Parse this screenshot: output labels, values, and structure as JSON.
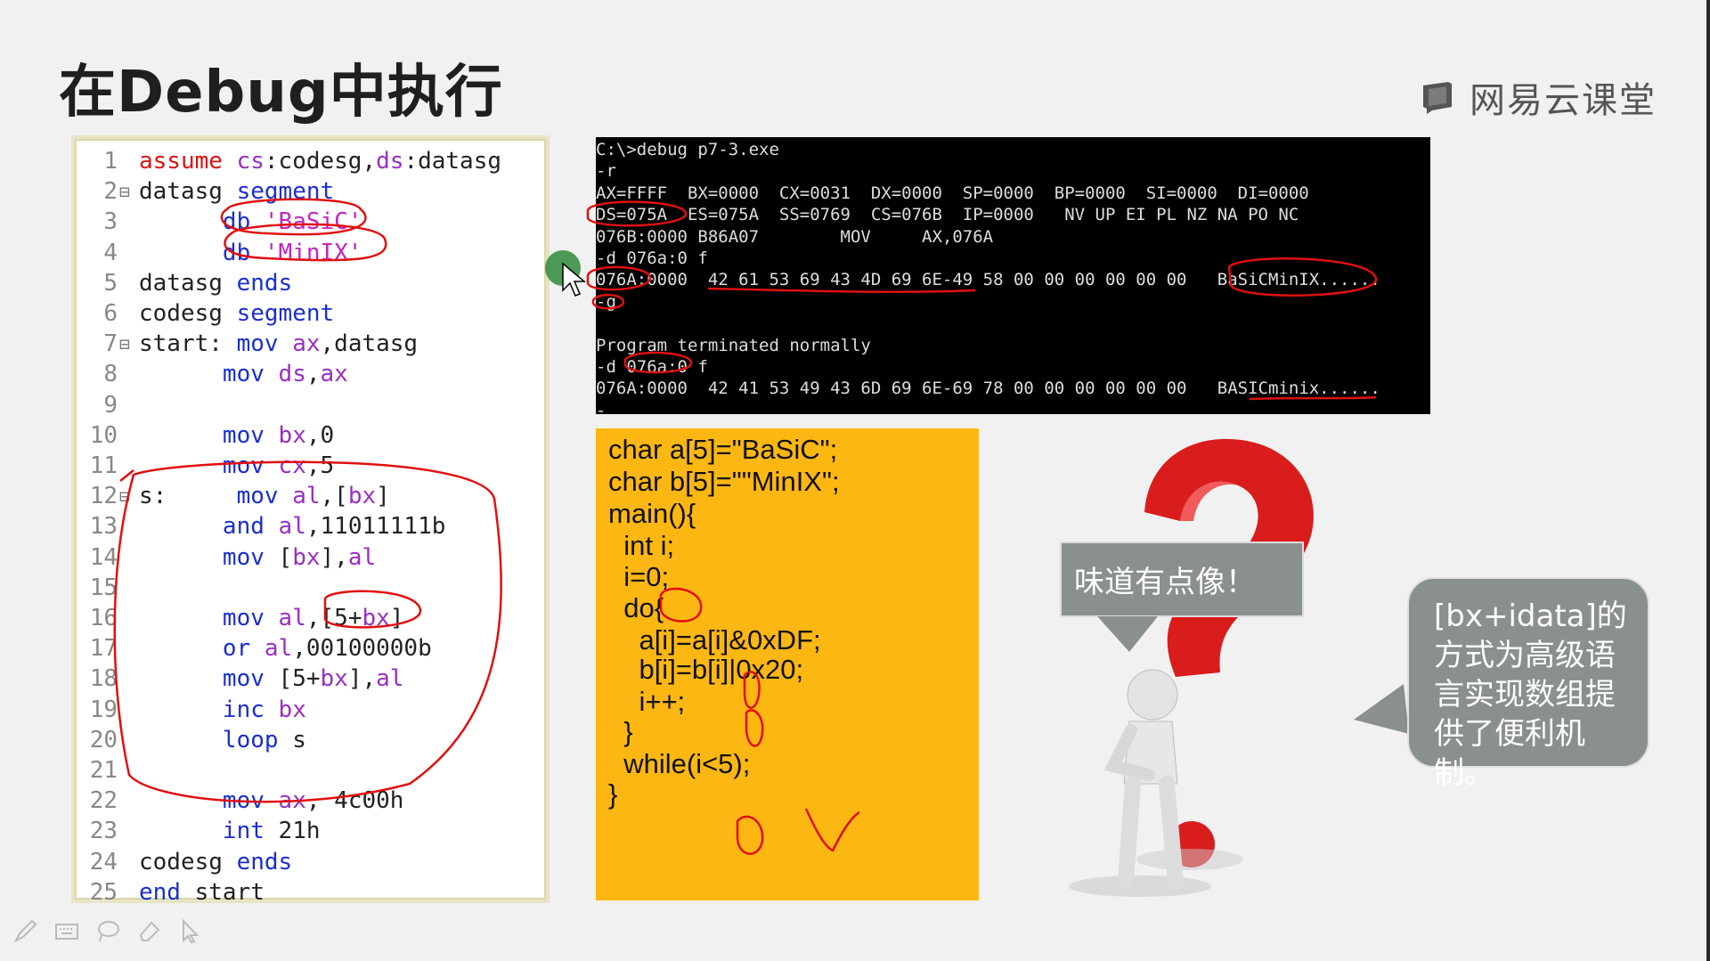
{
  "slide": {
    "title": "在Debug中执行",
    "brand": "网易云课堂"
  },
  "code": {
    "lines": [
      {
        "n": "1",
        "fold": "",
        "segs": [
          [
            "kw2",
            "assume "
          ],
          [
            "reg",
            "cs"
          ],
          [
            "plain",
            ":codesg,"
          ],
          [
            "reg",
            "ds"
          ],
          [
            "plain",
            ":datasg"
          ]
        ]
      },
      {
        "n": "2",
        "fold": "⊟",
        "segs": [
          [
            "plain",
            "datasg "
          ],
          [
            "kw",
            "segment"
          ]
        ]
      },
      {
        "n": "3",
        "fold": "",
        "segs": [
          [
            "plain",
            "      "
          ],
          [
            "kw",
            "db "
          ],
          [
            "str",
            "'BaSiC'"
          ]
        ]
      },
      {
        "n": "4",
        "fold": "",
        "segs": [
          [
            "plain",
            "      "
          ],
          [
            "kw",
            "db "
          ],
          [
            "str",
            "'MinIX'"
          ]
        ]
      },
      {
        "n": "5",
        "fold": "",
        "segs": [
          [
            "plain",
            "datasg "
          ],
          [
            "kw",
            "ends"
          ]
        ]
      },
      {
        "n": "6",
        "fold": "",
        "segs": [
          [
            "plain",
            "codesg "
          ],
          [
            "kw",
            "segment"
          ]
        ]
      },
      {
        "n": "7",
        "fold": "⊟",
        "segs": [
          [
            "plain",
            "start: "
          ],
          [
            "kw",
            "mov "
          ],
          [
            "reg",
            "ax"
          ],
          [
            "plain",
            ",datasg"
          ]
        ]
      },
      {
        "n": "8",
        "fold": "",
        "segs": [
          [
            "plain",
            "      "
          ],
          [
            "kw",
            "mov "
          ],
          [
            "reg",
            "ds"
          ],
          [
            "plain",
            ","
          ],
          [
            "reg",
            "ax"
          ]
        ]
      },
      {
        "n": "9",
        "fold": "",
        "segs": []
      },
      {
        "n": "10",
        "fold": "",
        "segs": [
          [
            "plain",
            "      "
          ],
          [
            "kw",
            "mov "
          ],
          [
            "reg",
            "bx"
          ],
          [
            "plain",
            ",0"
          ]
        ]
      },
      {
        "n": "11",
        "fold": "",
        "segs": [
          [
            "plain",
            "      "
          ],
          [
            "kw",
            "mov "
          ],
          [
            "reg",
            "cx"
          ],
          [
            "plain",
            ",5"
          ]
        ]
      },
      {
        "n": "12",
        "fold": "⊟",
        "segs": [
          [
            "plain",
            "s:     "
          ],
          [
            "kw",
            "mov "
          ],
          [
            "reg",
            "al"
          ],
          [
            "plain",
            ",["
          ],
          [
            "reg",
            "bx"
          ],
          [
            "plain",
            "]"
          ]
        ]
      },
      {
        "n": "13",
        "fold": "",
        "segs": [
          [
            "plain",
            "      "
          ],
          [
            "kw",
            "and "
          ],
          [
            "reg",
            "al"
          ],
          [
            "plain",
            ",11011111b"
          ]
        ]
      },
      {
        "n": "14",
        "fold": "",
        "segs": [
          [
            "plain",
            "      "
          ],
          [
            "kw",
            "mov "
          ],
          [
            "plain",
            "["
          ],
          [
            "reg",
            "bx"
          ],
          [
            "plain",
            "],"
          ],
          [
            "reg",
            "al"
          ]
        ]
      },
      {
        "n": "15",
        "fold": "",
        "segs": []
      },
      {
        "n": "16",
        "fold": "",
        "segs": [
          [
            "plain",
            "      "
          ],
          [
            "kw",
            "mov "
          ],
          [
            "reg",
            "al"
          ],
          [
            "plain",
            ",[5+"
          ],
          [
            "reg",
            "bx"
          ],
          [
            "plain",
            "]"
          ]
        ]
      },
      {
        "n": "17",
        "fold": "",
        "segs": [
          [
            "plain",
            "      "
          ],
          [
            "kw",
            "or "
          ],
          [
            "reg",
            "al"
          ],
          [
            "plain",
            ",00100000b"
          ]
        ]
      },
      {
        "n": "18",
        "fold": "",
        "segs": [
          [
            "plain",
            "      "
          ],
          [
            "kw",
            "mov "
          ],
          [
            "plain",
            "[5+"
          ],
          [
            "reg",
            "bx"
          ],
          [
            "plain",
            "],"
          ],
          [
            "reg",
            "al"
          ]
        ]
      },
      {
        "n": "19",
        "fold": "",
        "segs": [
          [
            "plain",
            "      "
          ],
          [
            "kw",
            "inc "
          ],
          [
            "reg",
            "bx"
          ]
        ]
      },
      {
        "n": "20",
        "fold": "",
        "segs": [
          [
            "plain",
            "      "
          ],
          [
            "kw",
            "loop "
          ],
          [
            "plain",
            "s"
          ]
        ]
      },
      {
        "n": "21",
        "fold": "",
        "segs": []
      },
      {
        "n": "22",
        "fold": "",
        "segs": [
          [
            "plain",
            "      "
          ],
          [
            "kw",
            "mov "
          ],
          [
            "reg",
            "ax"
          ],
          [
            "plain",
            ", 4c00h"
          ]
        ]
      },
      {
        "n": "23",
        "fold": "",
        "segs": [
          [
            "plain",
            "      "
          ],
          [
            "kw",
            "int "
          ],
          [
            "plain",
            "21h"
          ]
        ]
      },
      {
        "n": "24",
        "fold": "",
        "segs": [
          [
            "plain",
            "codesg "
          ],
          [
            "kw",
            "ends"
          ]
        ]
      },
      {
        "n": "25",
        "fold": "",
        "segs": [
          [
            "kw",
            "end "
          ],
          [
            "plain",
            "start"
          ]
        ]
      }
    ]
  },
  "terminal": {
    "lines": [
      "C:\\>debug p7-3.exe",
      "-r",
      "AX=FFFF  BX=0000  CX=0031  DX=0000  SP=0000  BP=0000  SI=0000  DI=0000",
      "DS=075A  ES=075A  SS=0769  CS=076B  IP=0000   NV UP EI PL NZ NA PO NC",
      "076B:0000 B86A07        MOV     AX,076A",
      "-d 076a:0 f",
      "076A:0000  42 61 53 69 43 4D 69 6E-49 58 00 00 00 00 00 00   BaSiCMinIX......",
      "-g",
      "",
      "Program terminated normally",
      "-d 076a:0 f",
      "076A:0000  42 41 53 49 43 6D 69 6E-69 78 00 00 00 00 00 00   BASICminix......",
      "-"
    ]
  },
  "c_code": {
    "lines": [
      "char a[5]=\"BaSiC\";",
      "char b[5]=\"\"MinIX\";",
      "main(){",
      "  int i;",
      "  i=0;",
      "  do{",
      "    a[i]=a[i]&0xDF;",
      "    b[i]=b[i]|0x20;",
      "    i++;",
      "  }",
      "  while(i<5);",
      "}"
    ]
  },
  "bubbles": {
    "left": "味道有点像！",
    "right": [
      "[bx+idata]的",
      "方式为高级语",
      "言实现数组提",
      "供了便利机制。"
    ]
  },
  "colors": {
    "annotation_red": "#e01010",
    "c_box_bg": "#fdb713",
    "bubble_gray": "#8a908d",
    "terminal_bg": "#000000"
  },
  "tools": [
    "pen-icon",
    "keyboard-icon",
    "lasso-icon",
    "eraser-icon",
    "pointer-icon"
  ]
}
